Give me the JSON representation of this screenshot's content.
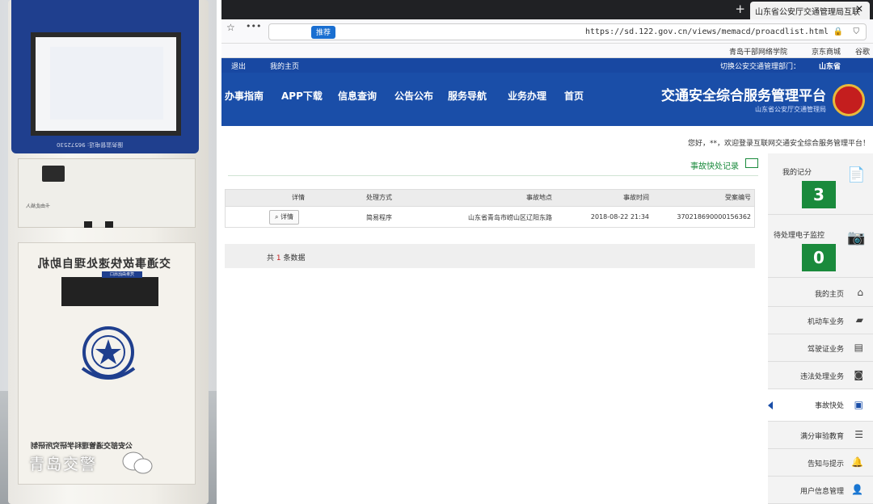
{
  "kiosk": {
    "hotline": "服务监督电话: 96572530",
    "notice": "卡由此插入",
    "machine_title": "交通事故快速处理自助机",
    "printer_label": "凭条由此出口",
    "maker": "公安部交通管理科学研究所研制",
    "watermark": "青岛交警"
  },
  "browser": {
    "tab_title": "山东省公安厅交通管理局互联",
    "tab_close": "✕",
    "new_tab": "+",
    "recommend_label": "推荐",
    "url": "https://sd.122.gov.cn/views/memacd/proacdlist.html",
    "more": "•••",
    "bookmarks": [
      "谷歌",
      "京东商城",
      "青岛干部网络学院"
    ]
  },
  "site": {
    "location_prefix": "切换公安交通管理部门：",
    "location_value": "山东省",
    "my_home": "我的主页",
    "logout": "退出",
    "title": "交通安全综合服务管理平台",
    "subtitle": "山东省公安厅交通管理局",
    "nav": [
      "首页",
      "业务办理",
      "服务导航",
      "公告公布",
      "信息查询",
      "APP下载",
      "办事指南"
    ],
    "greeting": "您好，**，欢迎登录互联网交通安全综合服务管理平台！"
  },
  "sidebar": {
    "score_label": "我的记分",
    "score_value": "3",
    "pending_label": "待处理电子监控",
    "pending_value": "0",
    "items": [
      {
        "label": "我的主页",
        "icon": "home-icon"
      },
      {
        "label": "机动车业务",
        "icon": "truck-icon"
      },
      {
        "label": "驾驶证业务",
        "icon": "card-icon"
      },
      {
        "label": "违法处理业务",
        "icon": "camera-icon"
      },
      {
        "label": "事故快处",
        "icon": "accident-icon",
        "active": true
      },
      {
        "label": "满分审验教育",
        "icon": "list-icon"
      },
      {
        "label": "告知与提示",
        "icon": "bell-icon"
      },
      {
        "label": "用户信息管理",
        "icon": "user-icon"
      }
    ]
  },
  "content": {
    "section_title": "事故快处记录",
    "columns": [
      "受案编号",
      "事故时间",
      "事故地点",
      "处理方式",
      "详情"
    ],
    "rows": [
      {
        "case_no": "370218690000156362",
        "time": "2018-08-22 21:34",
        "place": "山东省青岛市崂山区辽阳东路",
        "method": "简易程序",
        "detail": "详情"
      }
    ],
    "total_prefix": "共",
    "total_count": "1",
    "total_suffix": "条数据"
  },
  "colors": {
    "brand_blue": "#1a4ea8",
    "green": "#1a8a3c",
    "red": "#c41e1e"
  }
}
